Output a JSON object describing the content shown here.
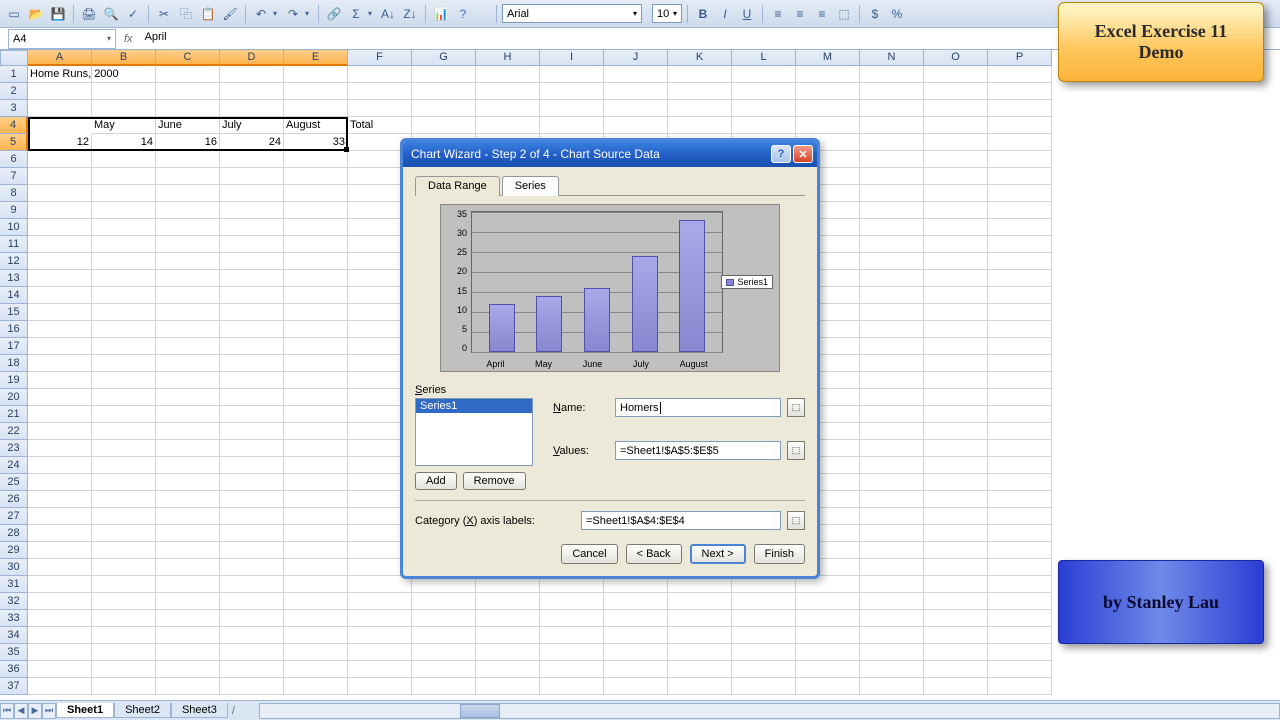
{
  "toolbar": {
    "font_name": "Arial",
    "font_size": "10"
  },
  "namebox": "A4",
  "formula": "April",
  "columns": [
    "A",
    "B",
    "C",
    "D",
    "E",
    "F",
    "G",
    "H",
    "I",
    "J",
    "K",
    "L",
    "M",
    "N",
    "O",
    "P"
  ],
  "rows": 37,
  "sel_cols": [
    0,
    1,
    2,
    3,
    4
  ],
  "sel_rows": [
    3,
    4
  ],
  "cells": {
    "r1": {
      "A": "Home Runs, 2000"
    },
    "r4": {
      "A": "April",
      "B": "May",
      "C": "June",
      "D": "July",
      "E": "August",
      "F": "Total"
    },
    "r5": {
      "A": "12",
      "B": "14",
      "C": "16",
      "D": "24",
      "E": "33"
    }
  },
  "dialog": {
    "title": "Chart Wizard - Step 2 of 4 - Chart Source Data",
    "tabs": {
      "data_range": "Data Range",
      "series": "Series"
    },
    "series_label": "Series",
    "series_items": [
      "Series1"
    ],
    "add": "Add",
    "remove": "Remove",
    "name_label": "Name:",
    "name_value": "Homers",
    "values_label": "Values:",
    "values_value": "=Sheet1!$A$5:$E$5",
    "cat_label": "Category (X) axis labels:",
    "cat_value": "=Sheet1!$A$4:$E$4",
    "cancel": "Cancel",
    "back": "< Back",
    "next": "Next >",
    "finish": "Finish",
    "legend": "Series1"
  },
  "chart_data": {
    "type": "bar",
    "categories": [
      "April",
      "May",
      "June",
      "July",
      "August"
    ],
    "values": [
      12,
      14,
      16,
      24,
      33
    ],
    "ylim": [
      0,
      35
    ],
    "yticks": [
      35,
      30,
      25,
      20,
      15,
      10,
      5,
      0
    ],
    "legend": [
      "Series1"
    ]
  },
  "sheets": [
    "Sheet1",
    "Sheet2",
    "Sheet3"
  ],
  "demo": {
    "l1": "Excel Exercise 11",
    "l2": "Demo"
  },
  "author": "by Stanley Lau"
}
